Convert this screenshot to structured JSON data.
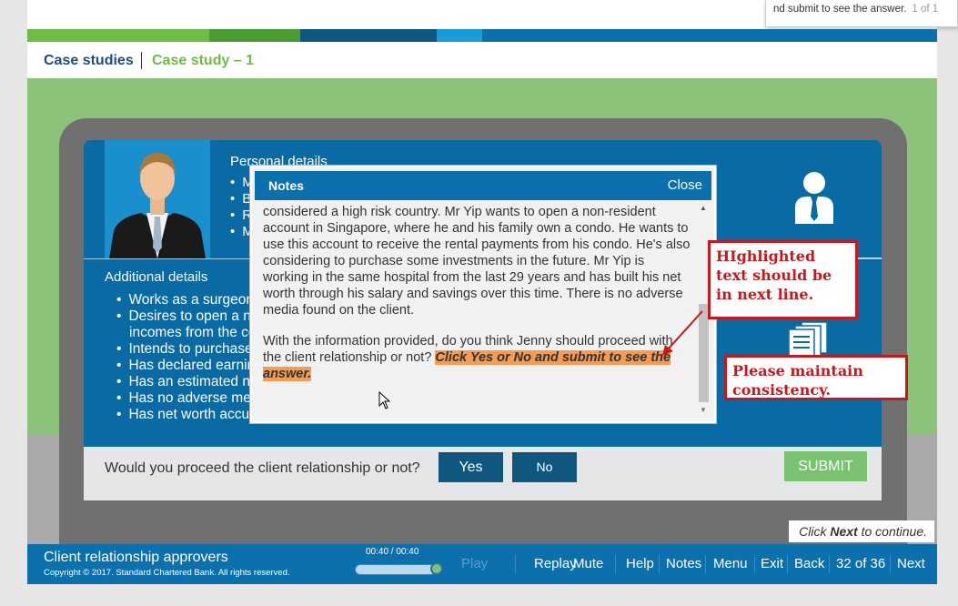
{
  "find_popup": {
    "text": "nd submit to see the answer.",
    "count": "1 of 1"
  },
  "colors": {
    "green": "#6cbd45",
    "darkblue": "#0f577f",
    "blue": "#0c70ad",
    "light_blue": "#1a9ad6",
    "highlight": "#f59b54",
    "annotation_red": "#c9171e"
  },
  "header": {
    "section": "Case studies",
    "title": "Case study – 1"
  },
  "personal": {
    "title": "Personal details",
    "items": [
      "M",
      "B",
      "R",
      "M"
    ]
  },
  "additional": {
    "title": "Additional details",
    "items": [
      "Works as a surgeon",
      "Desires to open a no",
      "incomes from the co",
      "Intends to purchase",
      "Has declared earnin",
      "Has an estimated ne",
      "Has no adverse med",
      "Has net worth accum"
    ]
  },
  "notes": {
    "title": "Notes",
    "close": "Close",
    "paragraph1": "considered a high risk country. Mr Yip wants to open a non-resident account in Singapore, where he and his family own a condo. He wants to use this account to receive the rental payments from his condo. He's also considering to purchase some investments in the future. Mr Yip is working in the same hospital from the last 29 years and has built his net worth through his salary and savings over this time. There is no adverse media found on the client.",
    "paragraph2_plain": "With the information provided, do you think Jenny should proceed with the client relationship or not? ",
    "paragraph2_highlight": "Click Yes or No and submit to see the answer."
  },
  "annotations": {
    "box1": "HIghlighted text should be in next line.",
    "box2": "Please maintain consistency."
  },
  "question": {
    "text": "Would you proceed the client relationship or not?",
    "yes": "Yes",
    "no": "No",
    "submit": "SUBMIT"
  },
  "continue_hint": {
    "pre": "Click ",
    "bold": "Next",
    "post": " to continue."
  },
  "footer": {
    "title": "Client relationship approvers",
    "copyright": "Copyright © 2017. Standard Chartered Bank. All rights reserved.",
    "time": "00:40 / 00:40",
    "progress": 1.0,
    "nav": {
      "play": "Play",
      "replay": "Replay",
      "mute": "Mute",
      "help": "Help",
      "notes": "Notes",
      "menu": "Menu",
      "exit": "Exit",
      "back": "Back",
      "page": "32 of 36",
      "next": "Next"
    }
  }
}
